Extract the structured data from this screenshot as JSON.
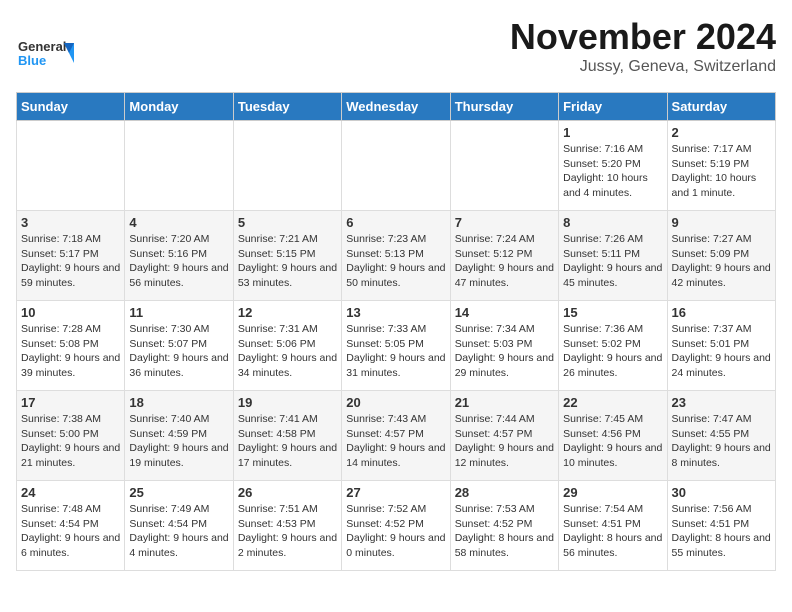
{
  "logo": {
    "line1": "General",
    "line2": "Blue"
  },
  "title": "November 2024",
  "location": "Jussy, Geneva, Switzerland",
  "days_of_week": [
    "Sunday",
    "Monday",
    "Tuesday",
    "Wednesday",
    "Thursday",
    "Friday",
    "Saturday"
  ],
  "weeks": [
    [
      {
        "day": "",
        "sunrise": "",
        "sunset": "",
        "daylight": ""
      },
      {
        "day": "",
        "sunrise": "",
        "sunset": "",
        "daylight": ""
      },
      {
        "day": "",
        "sunrise": "",
        "sunset": "",
        "daylight": ""
      },
      {
        "day": "",
        "sunrise": "",
        "sunset": "",
        "daylight": ""
      },
      {
        "day": "",
        "sunrise": "",
        "sunset": "",
        "daylight": ""
      },
      {
        "day": "1",
        "sunrise": "Sunrise: 7:16 AM",
        "sunset": "Sunset: 5:20 PM",
        "daylight": "Daylight: 10 hours and 4 minutes."
      },
      {
        "day": "2",
        "sunrise": "Sunrise: 7:17 AM",
        "sunset": "Sunset: 5:19 PM",
        "daylight": "Daylight: 10 hours and 1 minute."
      }
    ],
    [
      {
        "day": "3",
        "sunrise": "Sunrise: 7:18 AM",
        "sunset": "Sunset: 5:17 PM",
        "daylight": "Daylight: 9 hours and 59 minutes."
      },
      {
        "day": "4",
        "sunrise": "Sunrise: 7:20 AM",
        "sunset": "Sunset: 5:16 PM",
        "daylight": "Daylight: 9 hours and 56 minutes."
      },
      {
        "day": "5",
        "sunrise": "Sunrise: 7:21 AM",
        "sunset": "Sunset: 5:15 PM",
        "daylight": "Daylight: 9 hours and 53 minutes."
      },
      {
        "day": "6",
        "sunrise": "Sunrise: 7:23 AM",
        "sunset": "Sunset: 5:13 PM",
        "daylight": "Daylight: 9 hours and 50 minutes."
      },
      {
        "day": "7",
        "sunrise": "Sunrise: 7:24 AM",
        "sunset": "Sunset: 5:12 PM",
        "daylight": "Daylight: 9 hours and 47 minutes."
      },
      {
        "day": "8",
        "sunrise": "Sunrise: 7:26 AM",
        "sunset": "Sunset: 5:11 PM",
        "daylight": "Daylight: 9 hours and 45 minutes."
      },
      {
        "day": "9",
        "sunrise": "Sunrise: 7:27 AM",
        "sunset": "Sunset: 5:09 PM",
        "daylight": "Daylight: 9 hours and 42 minutes."
      }
    ],
    [
      {
        "day": "10",
        "sunrise": "Sunrise: 7:28 AM",
        "sunset": "Sunset: 5:08 PM",
        "daylight": "Daylight: 9 hours and 39 minutes."
      },
      {
        "day": "11",
        "sunrise": "Sunrise: 7:30 AM",
        "sunset": "Sunset: 5:07 PM",
        "daylight": "Daylight: 9 hours and 36 minutes."
      },
      {
        "day": "12",
        "sunrise": "Sunrise: 7:31 AM",
        "sunset": "Sunset: 5:06 PM",
        "daylight": "Daylight: 9 hours and 34 minutes."
      },
      {
        "day": "13",
        "sunrise": "Sunrise: 7:33 AM",
        "sunset": "Sunset: 5:05 PM",
        "daylight": "Daylight: 9 hours and 31 minutes."
      },
      {
        "day": "14",
        "sunrise": "Sunrise: 7:34 AM",
        "sunset": "Sunset: 5:03 PM",
        "daylight": "Daylight: 9 hours and 29 minutes."
      },
      {
        "day": "15",
        "sunrise": "Sunrise: 7:36 AM",
        "sunset": "Sunset: 5:02 PM",
        "daylight": "Daylight: 9 hours and 26 minutes."
      },
      {
        "day": "16",
        "sunrise": "Sunrise: 7:37 AM",
        "sunset": "Sunset: 5:01 PM",
        "daylight": "Daylight: 9 hours and 24 minutes."
      }
    ],
    [
      {
        "day": "17",
        "sunrise": "Sunrise: 7:38 AM",
        "sunset": "Sunset: 5:00 PM",
        "daylight": "Daylight: 9 hours and 21 minutes."
      },
      {
        "day": "18",
        "sunrise": "Sunrise: 7:40 AM",
        "sunset": "Sunset: 4:59 PM",
        "daylight": "Daylight: 9 hours and 19 minutes."
      },
      {
        "day": "19",
        "sunrise": "Sunrise: 7:41 AM",
        "sunset": "Sunset: 4:58 PM",
        "daylight": "Daylight: 9 hours and 17 minutes."
      },
      {
        "day": "20",
        "sunrise": "Sunrise: 7:43 AM",
        "sunset": "Sunset: 4:57 PM",
        "daylight": "Daylight: 9 hours and 14 minutes."
      },
      {
        "day": "21",
        "sunrise": "Sunrise: 7:44 AM",
        "sunset": "Sunset: 4:57 PM",
        "daylight": "Daylight: 9 hours and 12 minutes."
      },
      {
        "day": "22",
        "sunrise": "Sunrise: 7:45 AM",
        "sunset": "Sunset: 4:56 PM",
        "daylight": "Daylight: 9 hours and 10 minutes."
      },
      {
        "day": "23",
        "sunrise": "Sunrise: 7:47 AM",
        "sunset": "Sunset: 4:55 PM",
        "daylight": "Daylight: 9 hours and 8 minutes."
      }
    ],
    [
      {
        "day": "24",
        "sunrise": "Sunrise: 7:48 AM",
        "sunset": "Sunset: 4:54 PM",
        "daylight": "Daylight: 9 hours and 6 minutes."
      },
      {
        "day": "25",
        "sunrise": "Sunrise: 7:49 AM",
        "sunset": "Sunset: 4:54 PM",
        "daylight": "Daylight: 9 hours and 4 minutes."
      },
      {
        "day": "26",
        "sunrise": "Sunrise: 7:51 AM",
        "sunset": "Sunset: 4:53 PM",
        "daylight": "Daylight: 9 hours and 2 minutes."
      },
      {
        "day": "27",
        "sunrise": "Sunrise: 7:52 AM",
        "sunset": "Sunset: 4:52 PM",
        "daylight": "Daylight: 9 hours and 0 minutes."
      },
      {
        "day": "28",
        "sunrise": "Sunrise: 7:53 AM",
        "sunset": "Sunset: 4:52 PM",
        "daylight": "Daylight: 8 hours and 58 minutes."
      },
      {
        "day": "29",
        "sunrise": "Sunrise: 7:54 AM",
        "sunset": "Sunset: 4:51 PM",
        "daylight": "Daylight: 8 hours and 56 minutes."
      },
      {
        "day": "30",
        "sunrise": "Sunrise: 7:56 AM",
        "sunset": "Sunset: 4:51 PM",
        "daylight": "Daylight: 8 hours and 55 minutes."
      }
    ]
  ]
}
